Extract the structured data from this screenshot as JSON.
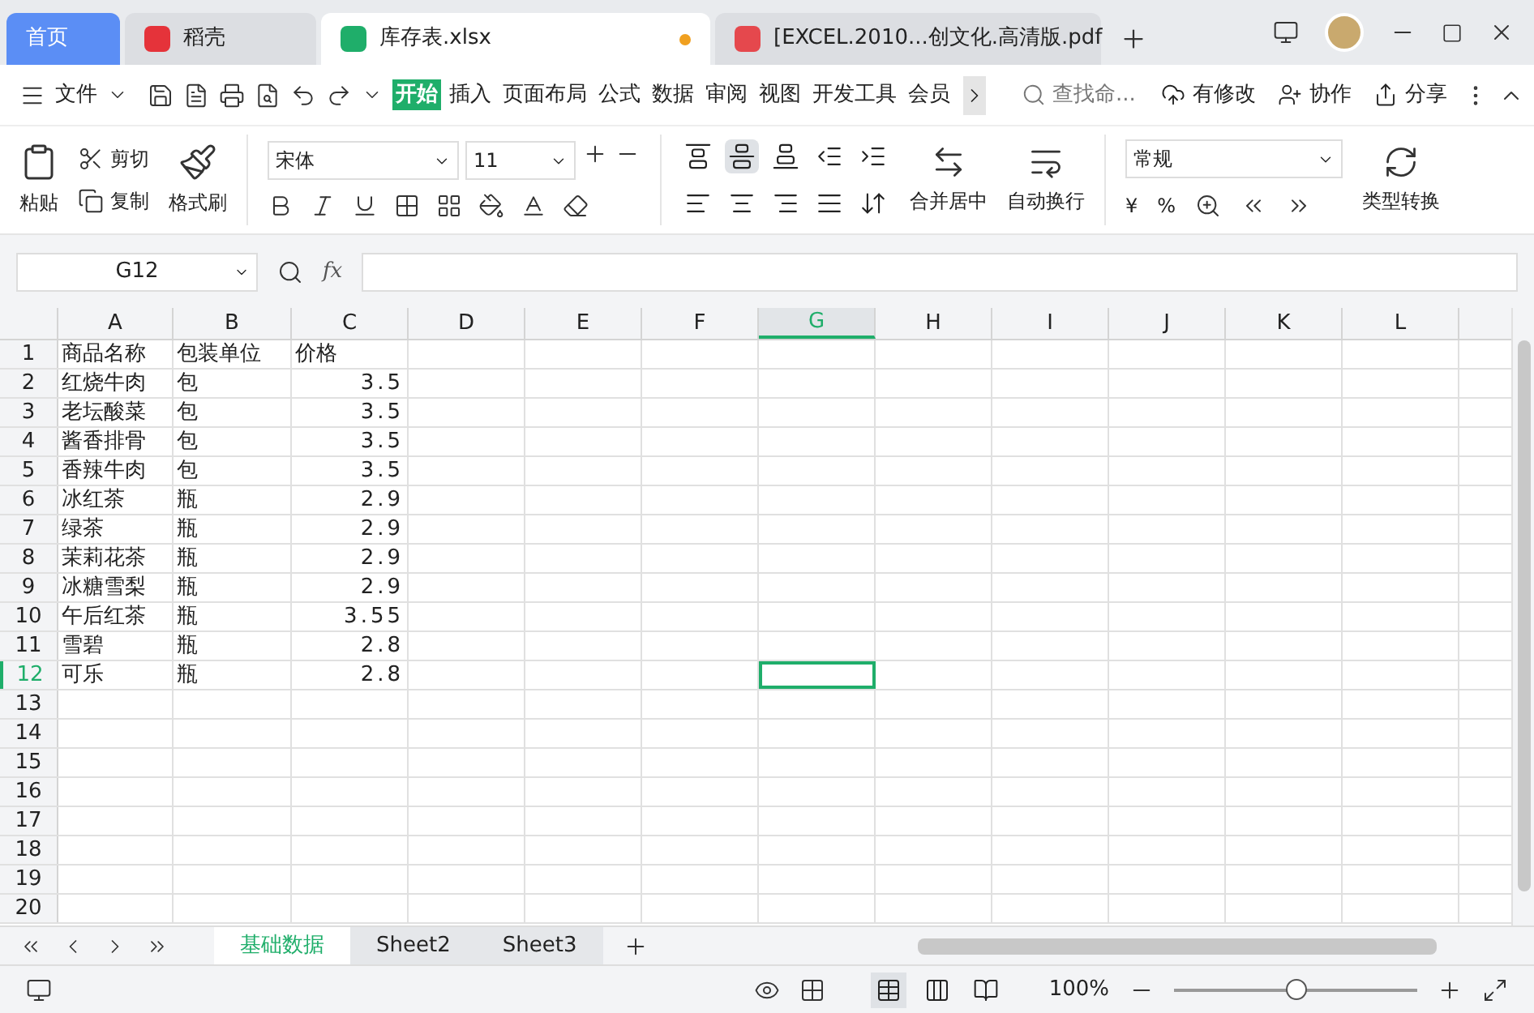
{
  "tabs": [
    {
      "label": "首页",
      "kind": "home",
      "selected": false
    },
    {
      "label": "稻壳",
      "kind": "docer",
      "selected": false
    },
    {
      "label": "库存表.xlsx",
      "kind": "sheet",
      "selected": true,
      "modified": true
    },
    {
      "label": "[EXCEL.2010...创文化.高清版.pdf",
      "kind": "pdf",
      "selected": false
    }
  ],
  "menu": {
    "file": "文件",
    "items": [
      {
        "label": "开始",
        "selected": true
      },
      {
        "label": "插入",
        "selected": false
      },
      {
        "label": "页面布局",
        "selected": false
      },
      {
        "label": "公式",
        "selected": false
      },
      {
        "label": "数据",
        "selected": false
      },
      {
        "label": "审阅",
        "selected": false
      },
      {
        "label": "视图",
        "selected": false
      },
      {
        "label": "开发工具",
        "selected": false
      },
      {
        "label": "会员",
        "selected": false
      }
    ],
    "search": {
      "placeholder": "查找命..."
    },
    "actions": [
      "有修改",
      "协作",
      "分享"
    ]
  },
  "ribbon": {
    "paste": "粘贴",
    "cut": "剪切",
    "copy": "复制",
    "format_painter": "格式刷",
    "font": "宋体",
    "font_size": "11",
    "align": [
      {
        "kind": "top",
        "selected": false
      },
      {
        "kind": "middle",
        "selected": true
      },
      {
        "kind": "bottom",
        "selected": false
      },
      {
        "kind": "outdent",
        "selected": false
      },
      {
        "kind": "indent",
        "selected": false
      },
      {
        "kind": "left",
        "selected": false
      },
      {
        "kind": "center",
        "selected": false
      },
      {
        "kind": "right",
        "selected": false
      },
      {
        "kind": "justify",
        "selected": false
      },
      {
        "kind": "distribute",
        "selected": false
      }
    ],
    "merge": "合并居中",
    "wrap": "自动换行",
    "number_format": "常规",
    "currency": "¥",
    "percent": "%",
    "convert": "类型转换"
  },
  "formula_bar": {
    "name_box": "G12",
    "fx": "fx"
  },
  "columns": [
    {
      "label": "A",
      "selected": false
    },
    {
      "label": "B",
      "selected": false
    },
    {
      "label": "C",
      "selected": false
    },
    {
      "label": "D",
      "selected": false
    },
    {
      "label": "E",
      "selected": false
    },
    {
      "label": "F",
      "selected": false
    },
    {
      "label": "G",
      "selected": true
    },
    {
      "label": "H",
      "selected": false
    },
    {
      "label": "I",
      "selected": false
    },
    {
      "label": "J",
      "selected": false
    },
    {
      "label": "K",
      "selected": false
    },
    {
      "label": "L",
      "selected": false
    }
  ],
  "rows": [
    {
      "number": "1",
      "selected": false,
      "cells": [
        "商品名称",
        "包装单位",
        "价格"
      ]
    },
    {
      "number": "2",
      "selected": false,
      "cells": [
        "红烧牛肉",
        "包",
        "3.5"
      ]
    },
    {
      "number": "3",
      "selected": false,
      "cells": [
        "老坛酸菜",
        "包",
        "3.5"
      ]
    },
    {
      "number": "4",
      "selected": false,
      "cells": [
        "酱香排骨",
        "包",
        "3.5"
      ]
    },
    {
      "number": "5",
      "selected": false,
      "cells": [
        "香辣牛肉",
        "包",
        "3.5"
      ]
    },
    {
      "number": "6",
      "selected": false,
      "cells": [
        "冰红茶",
        "瓶",
        "2.9"
      ]
    },
    {
      "number": "7",
      "selected": false,
      "cells": [
        "绿茶",
        "瓶",
        "2.9"
      ]
    },
    {
      "number": "8",
      "selected": false,
      "cells": [
        "茉莉花茶",
        "瓶",
        "2.9"
      ]
    },
    {
      "number": "9",
      "selected": false,
      "cells": [
        "冰糖雪梨",
        "瓶",
        "2.9"
      ]
    },
    {
      "number": "10",
      "selected": false,
      "cells": [
        "午后红茶",
        "瓶",
        "3.55"
      ]
    },
    {
      "number": "11",
      "selected": false,
      "cells": [
        "雪碧",
        "瓶",
        "2.8"
      ]
    },
    {
      "number": "12",
      "selected": true,
      "cells": [
        "可乐",
        "瓶",
        "2.8"
      ]
    },
    {
      "number": "13",
      "selected": false
    },
    {
      "number": "14",
      "selected": false
    },
    {
      "number": "15",
      "selected": false
    },
    {
      "number": "16",
      "selected": false
    },
    {
      "number": "17",
      "selected": false
    },
    {
      "number": "18",
      "selected": false
    },
    {
      "number": "19",
      "selected": false
    },
    {
      "number": "20",
      "selected": false
    }
  ],
  "sheets": [
    {
      "label": "基础数据",
      "selected": true
    },
    {
      "label": "Sheet2",
      "selected": false
    },
    {
      "label": "Sheet3",
      "selected": false
    }
  ],
  "status": {
    "views": [
      {
        "kind": "normal",
        "selected": true
      },
      {
        "kind": "page",
        "selected": false
      },
      {
        "kind": "break",
        "selected": false
      }
    ],
    "zoom": "100%",
    "zoom_slider": {
      "level": 0.5
    }
  }
}
